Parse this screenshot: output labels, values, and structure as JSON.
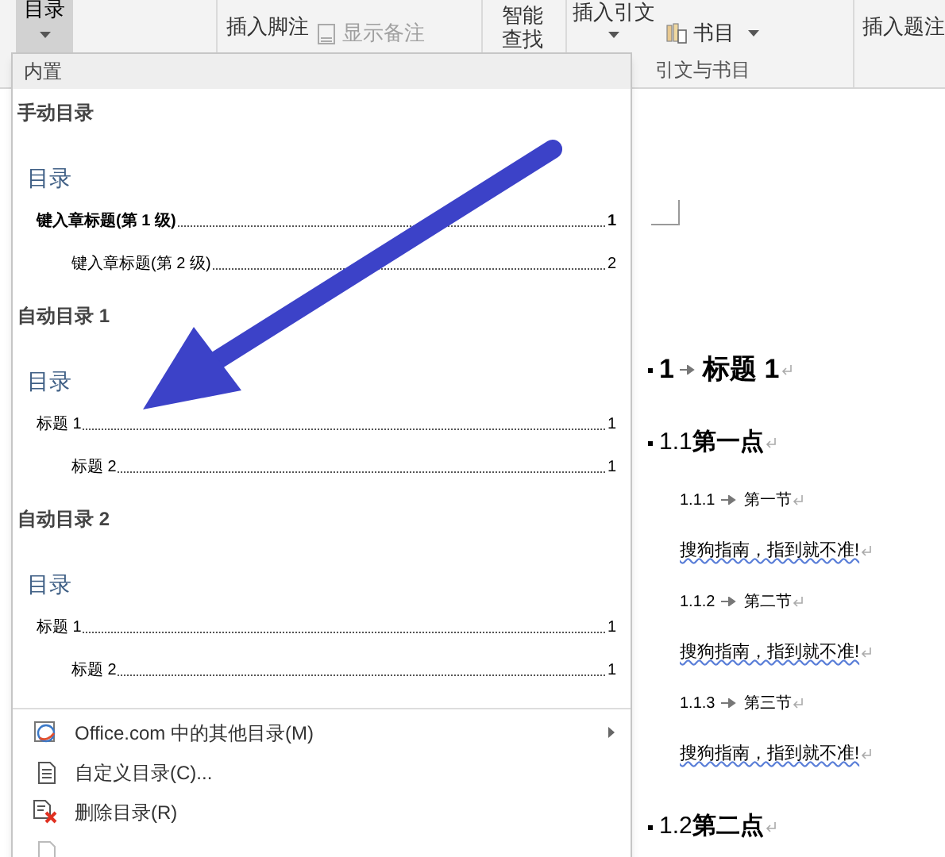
{
  "ribbon": {
    "buttons": [
      {
        "label": "目录",
        "kind": "toc",
        "pressed": true
      },
      {
        "label": "插入脚注",
        "kind": "plain",
        "pressed": false
      },
      {
        "label": "显示备注",
        "kind": "notes",
        "disabled": true
      },
      {
        "label": "智能查找",
        "kind": "plain",
        "pressed": false
      },
      {
        "label": "插入引文",
        "kind": "caret",
        "pressed": false
      },
      {
        "label": "书目",
        "kind": "bib",
        "pressed": false
      },
      {
        "label": "插入题注",
        "kind": "plain",
        "pressed": false
      }
    ],
    "group_label": "引文与书目"
  },
  "toc_menu": {
    "header": "内置",
    "sections": [
      {
        "title": "手动目录",
        "preview": {
          "heading": "目录",
          "entries": [
            {
              "text": "键入章标题(第 1 级)",
              "page": "1",
              "bold": true,
              "children": [
                {
                  "text": "键入章标题(第 2 级)",
                  "page": "2",
                  "bold": false
                }
              ]
            }
          ]
        }
      },
      {
        "title": "自动目录 1",
        "preview": {
          "heading": "目录",
          "entries": [
            {
              "text": "标题 1",
              "page": "1",
              "bold": false,
              "children": [
                {
                  "text": "标题 2",
                  "page": "1",
                  "bold": false
                }
              ]
            }
          ]
        }
      },
      {
        "title": "自动目录 2",
        "preview": {
          "heading": "目录",
          "entries": [
            {
              "text": "标题 1",
              "page": "1",
              "bold": false,
              "children": [
                {
                  "text": "标题 2",
                  "page": "1",
                  "bold": false
                }
              ]
            }
          ]
        }
      }
    ],
    "menu_items": [
      {
        "label": "Office.com 中的其他目录(M)",
        "kind": "web",
        "submenu": true
      },
      {
        "label": "自定义目录(C)...",
        "kind": "custom",
        "submenu": false
      },
      {
        "label": "删除目录(R)",
        "kind": "remove",
        "submenu": false
      }
    ]
  },
  "document": {
    "lines": [
      {
        "kind": "h1",
        "number": "1",
        "text": "标题 1"
      },
      {
        "kind": "h2",
        "number": "1.1",
        "text": "第一点"
      },
      {
        "kind": "h3",
        "number": "1.1.1",
        "text": "第一节"
      },
      {
        "kind": "body",
        "text": "搜狗指南，指到就不准!"
      },
      {
        "kind": "h3",
        "number": "1.1.2",
        "text": "第二节"
      },
      {
        "kind": "body",
        "text": "搜狗指南，指到就不准!"
      },
      {
        "kind": "h3",
        "number": "1.1.3",
        "text": "第三节"
      },
      {
        "kind": "body",
        "text": "搜狗指南，指到就不准!"
      },
      {
        "kind": "h2",
        "number": "1.2",
        "text": "第二点"
      }
    ]
  }
}
